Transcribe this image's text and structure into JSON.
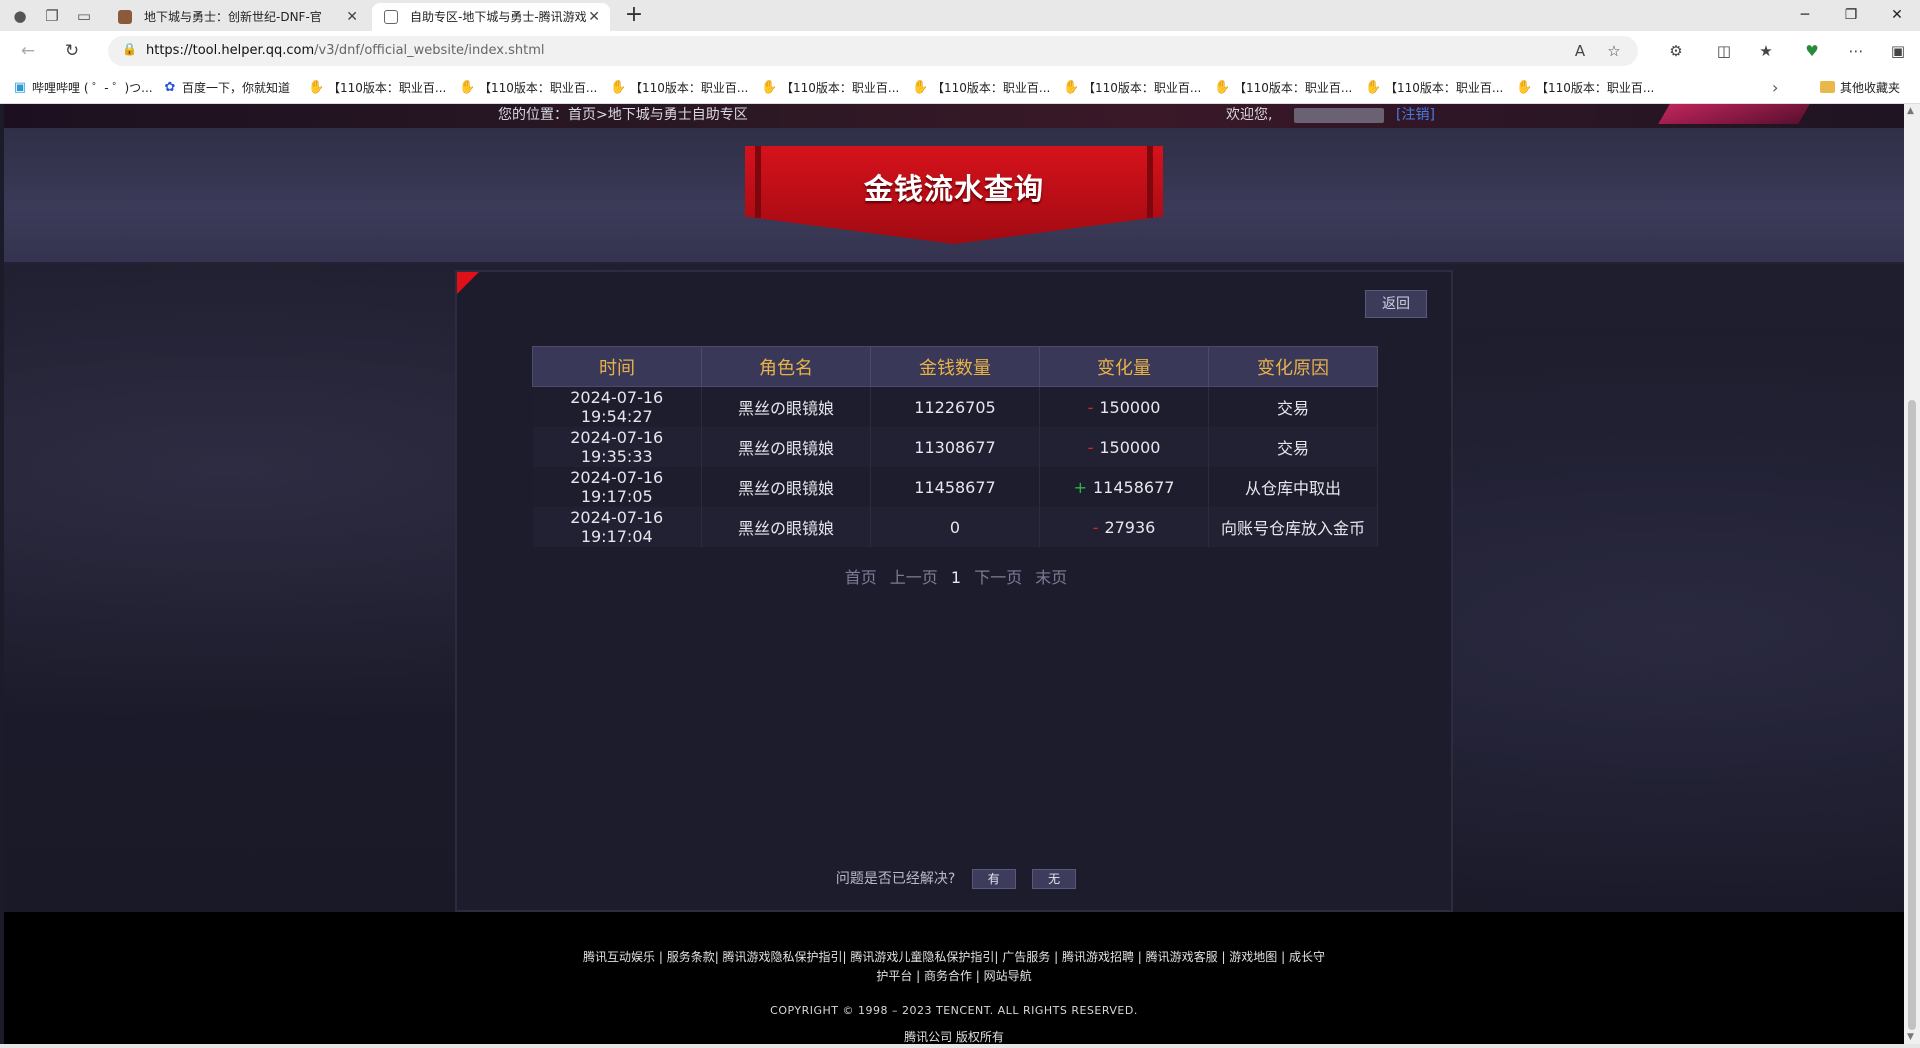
{
  "browser": {
    "tabs": [
      {
        "title": "地下城与勇士：创新世纪-DNF-官",
        "active": false
      },
      {
        "title": "自助专区-地下城与勇士-腾讯游戏",
        "active": true
      }
    ],
    "url_host": "https://tool.helper.qq.com",
    "url_path": "/v3/dnf/official_website/index.shtml",
    "bookmarks": [
      "哔哩哔哩 ( ゜- ゜)つ...",
      "百度一下，你就知道",
      "【110版本：职业百...",
      "【110版本：职业百...",
      "【110版本：职业百...",
      "【110版本：职业百...",
      "【110版本：职业百...",
      "【110版本：职业百...",
      "【110版本：职业百...",
      "【110版本：职业百...",
      "【110版本：职业百..."
    ],
    "bookmark_folder": "其他收藏夹"
  },
  "header": {
    "location": "您的位置：首页>地下城与勇士自助专区",
    "welcome": "欢迎您,",
    "logout": "[注销]"
  },
  "title": "金钱流水查询",
  "back_label": "返回",
  "table": {
    "headers": [
      "时间",
      "角色名",
      "金钱数量",
      "变化量",
      "变化原因"
    ],
    "rows": [
      {
        "time": "2024-07-16 19:54:27",
        "role": "黑丝の眼镜娘",
        "amount": "11226705",
        "sign": "-",
        "change": "150000",
        "reason": "交易"
      },
      {
        "time": "2024-07-16 19:35:33",
        "role": "黑丝の眼镜娘",
        "amount": "11308677",
        "sign": "-",
        "change": "150000",
        "reason": "交易"
      },
      {
        "time": "2024-07-16 19:17:05",
        "role": "黑丝の眼镜娘",
        "amount": "11458677",
        "sign": "+",
        "change": "11458677",
        "reason": "从仓库中取出"
      },
      {
        "time": "2024-07-16 19:17:04",
        "role": "黑丝の眼镜娘",
        "amount": "0",
        "sign": "-",
        "change": "27936",
        "reason": "向账号仓库放入金币"
      }
    ]
  },
  "pager": {
    "first": "首页",
    "prev": "上一页",
    "current": "1",
    "next": "下一页",
    "last": "末页"
  },
  "resolved": {
    "question": "问题是否已经解决?",
    "yes": "有",
    "no": "无"
  },
  "footer": {
    "links_line1": "腾讯互动娱乐 | 服务条款| 腾讯游戏隐私保护指引| 腾讯游戏儿童隐私保护指引| 广告服务 | 腾讯游戏招聘 | 腾讯游戏客服 | 游戏地图 | 成长守",
    "links_line2": "护平台 | 商务合作 | 网站导航",
    "copyright": "COPYRIGHT © 1998 – 2023 TENCENT. ALL RIGHTS RESERVED.",
    "rights": "腾讯公司 版权所有"
  },
  "colors": {
    "header_gold": "#e6b24a",
    "ribbon_red": "#d6121c",
    "minus_red": "#e0242c",
    "plus_green": "#2fb34a",
    "link_blue": "#4a7be0"
  }
}
